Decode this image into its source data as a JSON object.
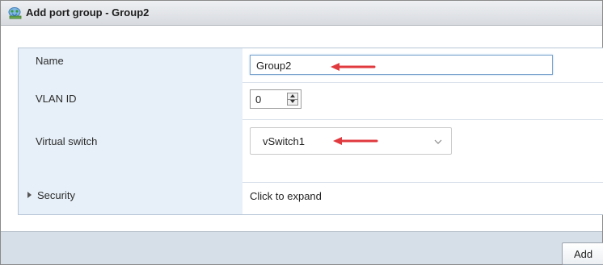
{
  "window": {
    "title": "Add port group - Group2",
    "icon": "network-port-group-icon"
  },
  "form": {
    "name": {
      "label": "Name",
      "value": "Group2"
    },
    "vlan": {
      "label": "VLAN ID",
      "value": "0"
    },
    "vswitch": {
      "label": "Virtual switch",
      "selected": "vSwitch1",
      "options": [
        "vSwitch1"
      ]
    },
    "security": {
      "label": "Security",
      "hint": "Click to expand"
    }
  },
  "footer": {
    "add_label": "Add"
  },
  "colors": {
    "annotation_arrow": "#e0393e",
    "label_column_bg": "#e7f0f8",
    "footer_bg": "#d6dee7"
  }
}
